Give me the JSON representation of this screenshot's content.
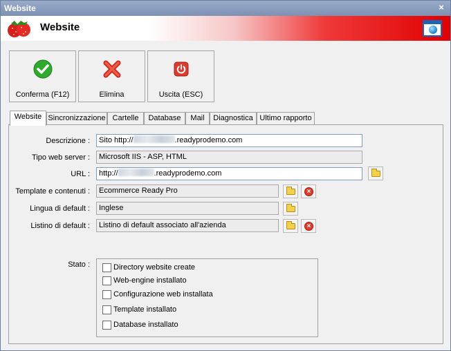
{
  "window": {
    "title": "Website",
    "close_glyph": "×"
  },
  "header": {
    "title": "Website",
    "logo_icon": "strawberry-logo",
    "window_icon": "browser-globe-icon"
  },
  "toolbar": {
    "confirm_label": "Conferma (F12)",
    "delete_label": "Elimina",
    "exit_label": "Uscita (ESC)"
  },
  "tabs": [
    "Website",
    "Sincronizzazione",
    "Cartelle",
    "Database",
    "Mail",
    "Diagnostica",
    "Ultimo rapporto"
  ],
  "form": {
    "descrizione": {
      "label": "Descrizione :",
      "prefix": "Sito http://",
      "suffix": ".readyprodemo.com"
    },
    "tipo_server": {
      "label": "Tipo web server :",
      "value": "Microsoft IIS - ASP, HTML"
    },
    "url": {
      "label": "URL :",
      "prefix": "http://",
      "suffix": ".readyprodemo.com"
    },
    "template": {
      "label": "Template e contenuti :",
      "value": "Ecommerce Ready Pro"
    },
    "lingua": {
      "label": "Lingua di default :",
      "value": "Inglese"
    },
    "listino": {
      "label": "Listino di default :",
      "value": "Listino di default associato all'azienda"
    }
  },
  "stato": {
    "label": "Stato :",
    "items": [
      {
        "label": "Directory website create",
        "checked": false
      },
      {
        "label": "Web-engine installato",
        "checked": false
      },
      {
        "label": "Configurazione web installata",
        "checked": false
      },
      {
        "label": "Template installato",
        "checked": false
      },
      {
        "label": "Database installato",
        "checked": false
      }
    ]
  }
}
